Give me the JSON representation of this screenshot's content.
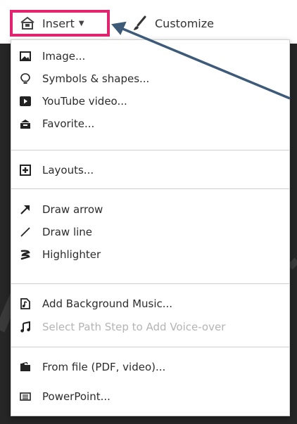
{
  "toolbar": {
    "insert_label": "Insert",
    "customize_label": "Customize"
  },
  "menu": {
    "items": [
      {
        "label": "Image...",
        "icon": "image-icon",
        "enabled": true
      },
      {
        "label": "Symbols & shapes...",
        "icon": "lightbulb-icon",
        "enabled": true
      },
      {
        "label": "YouTube video...",
        "icon": "youtube-icon",
        "enabled": true
      },
      {
        "label": "Favorite...",
        "icon": "favorite-icon",
        "enabled": true
      },
      {
        "label": "Layouts...",
        "icon": "layouts-icon",
        "enabled": true
      },
      {
        "label": "Draw arrow",
        "icon": "draw-arrow-icon",
        "enabled": true
      },
      {
        "label": "Draw line",
        "icon": "draw-line-icon",
        "enabled": true
      },
      {
        "label": "Highlighter",
        "icon": "highlighter-icon",
        "enabled": true
      },
      {
        "label": "Add Background Music...",
        "icon": "music-file-icon",
        "enabled": true
      },
      {
        "label": "Select Path Step to Add Voice-over",
        "icon": "music-note-icon",
        "enabled": false
      },
      {
        "label": "From file (PDF, video)...",
        "icon": "folder-icon",
        "enabled": true
      },
      {
        "label": "PowerPoint...",
        "icon": "powerpoint-icon",
        "enabled": true
      }
    ]
  },
  "colors": {
    "highlight_border": "#e0246e",
    "annotation_arrow": "#3d5a78",
    "disabled_text": "#b4b4b4"
  }
}
